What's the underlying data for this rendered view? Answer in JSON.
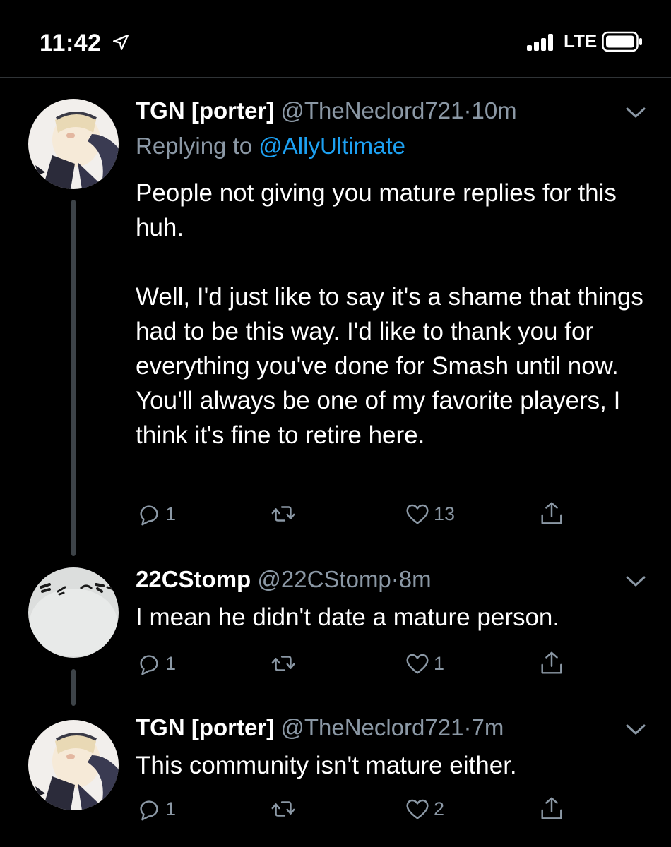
{
  "status_bar": {
    "time": "11:42",
    "network": "LTE",
    "icons": [
      "location-arrow-icon",
      "signal-bars-icon",
      "battery-icon"
    ]
  },
  "colors": {
    "background": "#000000",
    "text": "#ffffff",
    "secondary": "#8b98a5",
    "link": "#1da1f2",
    "thread_line": "#3d4348"
  },
  "tweets": [
    {
      "name": "TGN [porter]",
      "handle": "@TheNeclord721",
      "separator": "·",
      "time": "10m",
      "replying_prefix": "Replying to",
      "replying_to": "@AllyUltimate",
      "text_paragraphs": [
        "People not giving you mature replies for this huh.",
        "Well, I'd just like to say it's a shame that things had to be this way. I'd like to thank you for everything you've done for Smash until now. You'll always be one of my favorite players, I think it's fine to retire here."
      ],
      "replies": "1",
      "retweets": "",
      "likes": "13"
    },
    {
      "name": "22CStomp",
      "handle": "@22CStomp",
      "separator": "·",
      "time": "8m",
      "text": "I mean he didn't date a mature person.",
      "replies": "1",
      "retweets": "",
      "likes": "1"
    },
    {
      "name": "TGN [porter]",
      "handle": "@TheNeclord721",
      "separator": "·",
      "time": "7m",
      "text": "This community isn't mature either.",
      "replies": "1",
      "retweets": "",
      "likes": "2"
    }
  ]
}
